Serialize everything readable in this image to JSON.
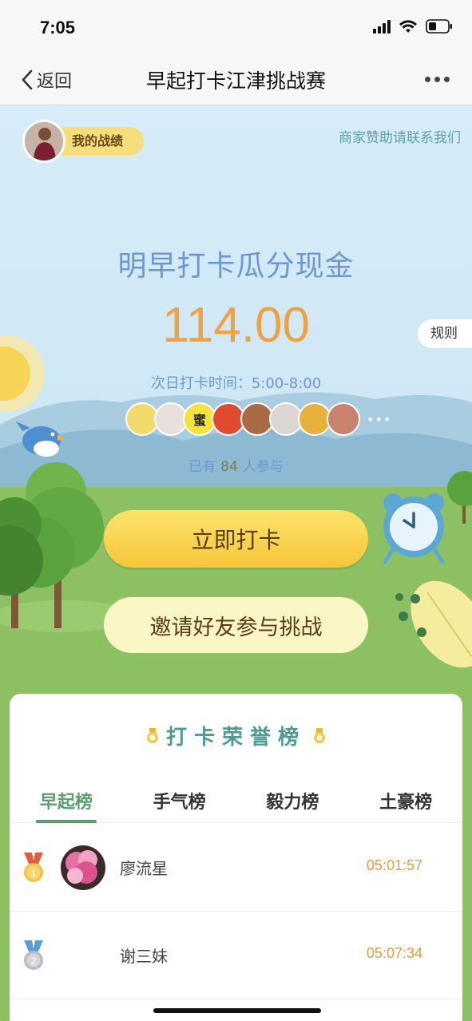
{
  "status_bar": {
    "time": "7:05"
  },
  "nav": {
    "back_label": "返回",
    "title": "早起打卡江津挑战赛"
  },
  "hero": {
    "my_record_label": "我的战绩",
    "sponsor_link": "商家赞助请联系我们",
    "headline": "明早打卡瓜分现金",
    "amount": "114.00",
    "rules_label": "规则",
    "checkin_time": "次日打卡时间：5:00-8:00",
    "avatar_glyphs": [
      "",
      "",
      "蜜",
      "",
      "",
      "",
      "",
      ""
    ],
    "participants_prefix": "已有",
    "participants_count": "84",
    "participants_suffix": "人参与"
  },
  "actions": {
    "checkin_label": "立即打卡",
    "invite_label": "邀请好友参与挑战"
  },
  "leaderboard": {
    "title": "打卡荣誉榜",
    "tabs": [
      {
        "label": "早起榜",
        "active": true
      },
      {
        "label": "手气榜",
        "active": false
      },
      {
        "label": "毅力榜",
        "active": false
      },
      {
        "label": "土豪榜",
        "active": false
      }
    ],
    "rows": [
      {
        "rank": "1",
        "name": "廖流星",
        "time": "05:01:57"
      },
      {
        "rank": "2",
        "name": "谢三妹",
        "time": "05:07:34"
      }
    ]
  },
  "colors": {
    "accent_green": "#5aa06a",
    "amount_orange": "#efa240",
    "headline_blue": "#6d96d6",
    "time_orange": "#e89a3f"
  }
}
